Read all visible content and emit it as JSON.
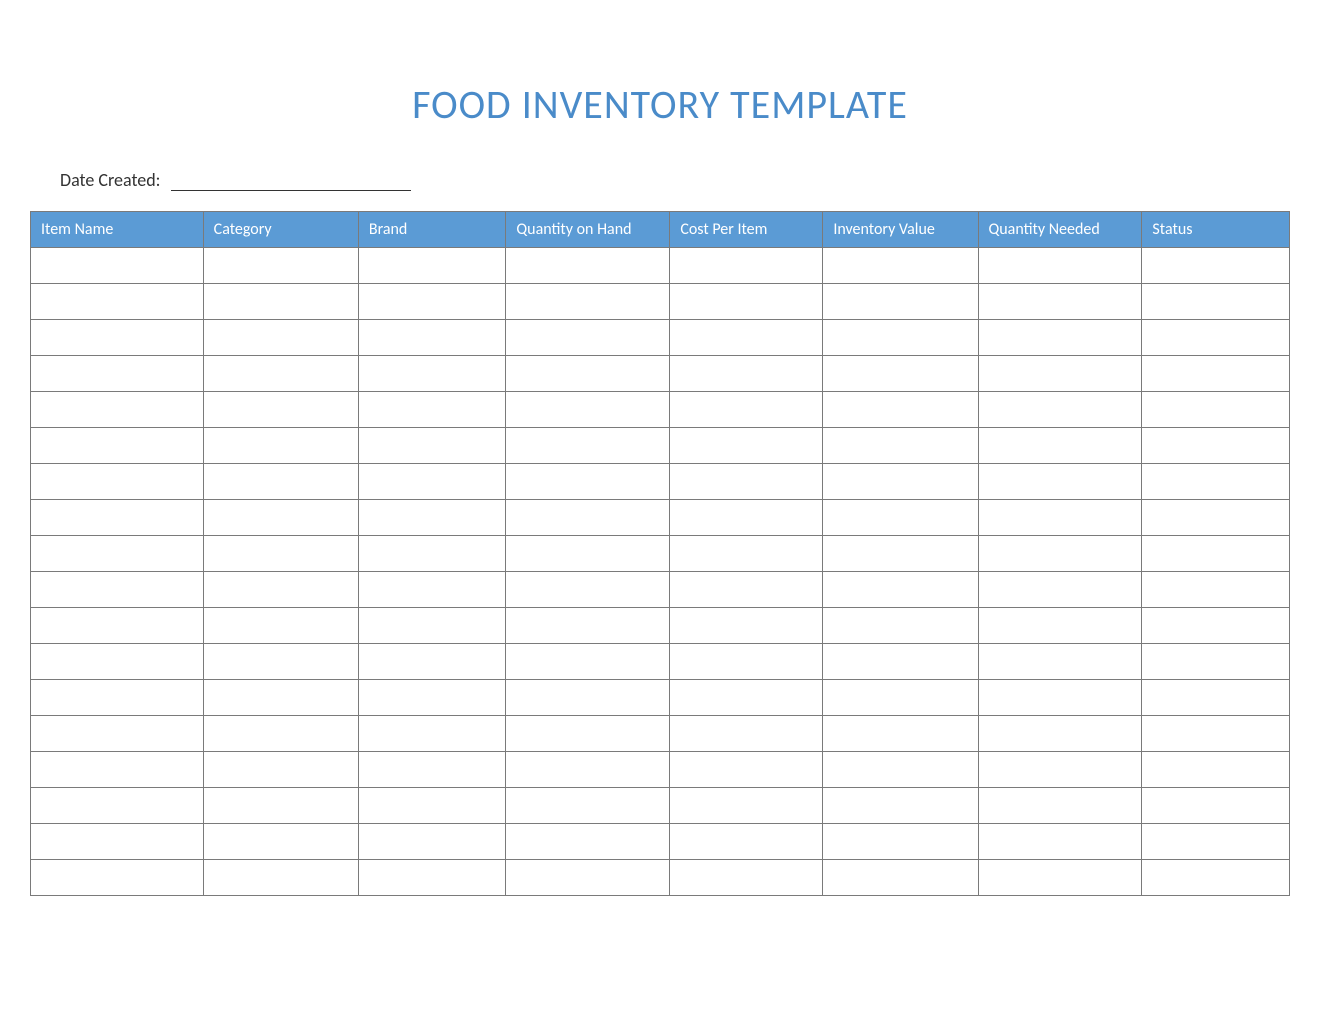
{
  "title": "FOOD INVENTORY TEMPLATE",
  "date_created_label": "Date Created:",
  "date_created_value": "",
  "table": {
    "headers": [
      "Item Name",
      "Category",
      "Brand",
      "Quantity on Hand",
      "Cost Per Item",
      "Inventory Value",
      "Quantity Needed",
      "Status"
    ],
    "rows": [
      [
        "",
        "",
        "",
        "",
        "",
        "",
        "",
        ""
      ],
      [
        "",
        "",
        "",
        "",
        "",
        "",
        "",
        ""
      ],
      [
        "",
        "",
        "",
        "",
        "",
        "",
        "",
        ""
      ],
      [
        "",
        "",
        "",
        "",
        "",
        "",
        "",
        ""
      ],
      [
        "",
        "",
        "",
        "",
        "",
        "",
        "",
        ""
      ],
      [
        "",
        "",
        "",
        "",
        "",
        "",
        "",
        ""
      ],
      [
        "",
        "",
        "",
        "",
        "",
        "",
        "",
        ""
      ],
      [
        "",
        "",
        "",
        "",
        "",
        "",
        "",
        ""
      ],
      [
        "",
        "",
        "",
        "",
        "",
        "",
        "",
        ""
      ],
      [
        "",
        "",
        "",
        "",
        "",
        "",
        "",
        ""
      ],
      [
        "",
        "",
        "",
        "",
        "",
        "",
        "",
        ""
      ],
      [
        "",
        "",
        "",
        "",
        "",
        "",
        "",
        ""
      ],
      [
        "",
        "",
        "",
        "",
        "",
        "",
        "",
        ""
      ],
      [
        "",
        "",
        "",
        "",
        "",
        "",
        "",
        ""
      ],
      [
        "",
        "",
        "",
        "",
        "",
        "",
        "",
        ""
      ],
      [
        "",
        "",
        "",
        "",
        "",
        "",
        "",
        ""
      ],
      [
        "",
        "",
        "",
        "",
        "",
        "",
        "",
        ""
      ],
      [
        "",
        "",
        "",
        "",
        "",
        "",
        "",
        ""
      ]
    ]
  },
  "colors": {
    "title": "#4a8bc9",
    "header_bg": "#5b9bd5",
    "header_text": "#ffffff",
    "border": "#7a7a7a"
  }
}
